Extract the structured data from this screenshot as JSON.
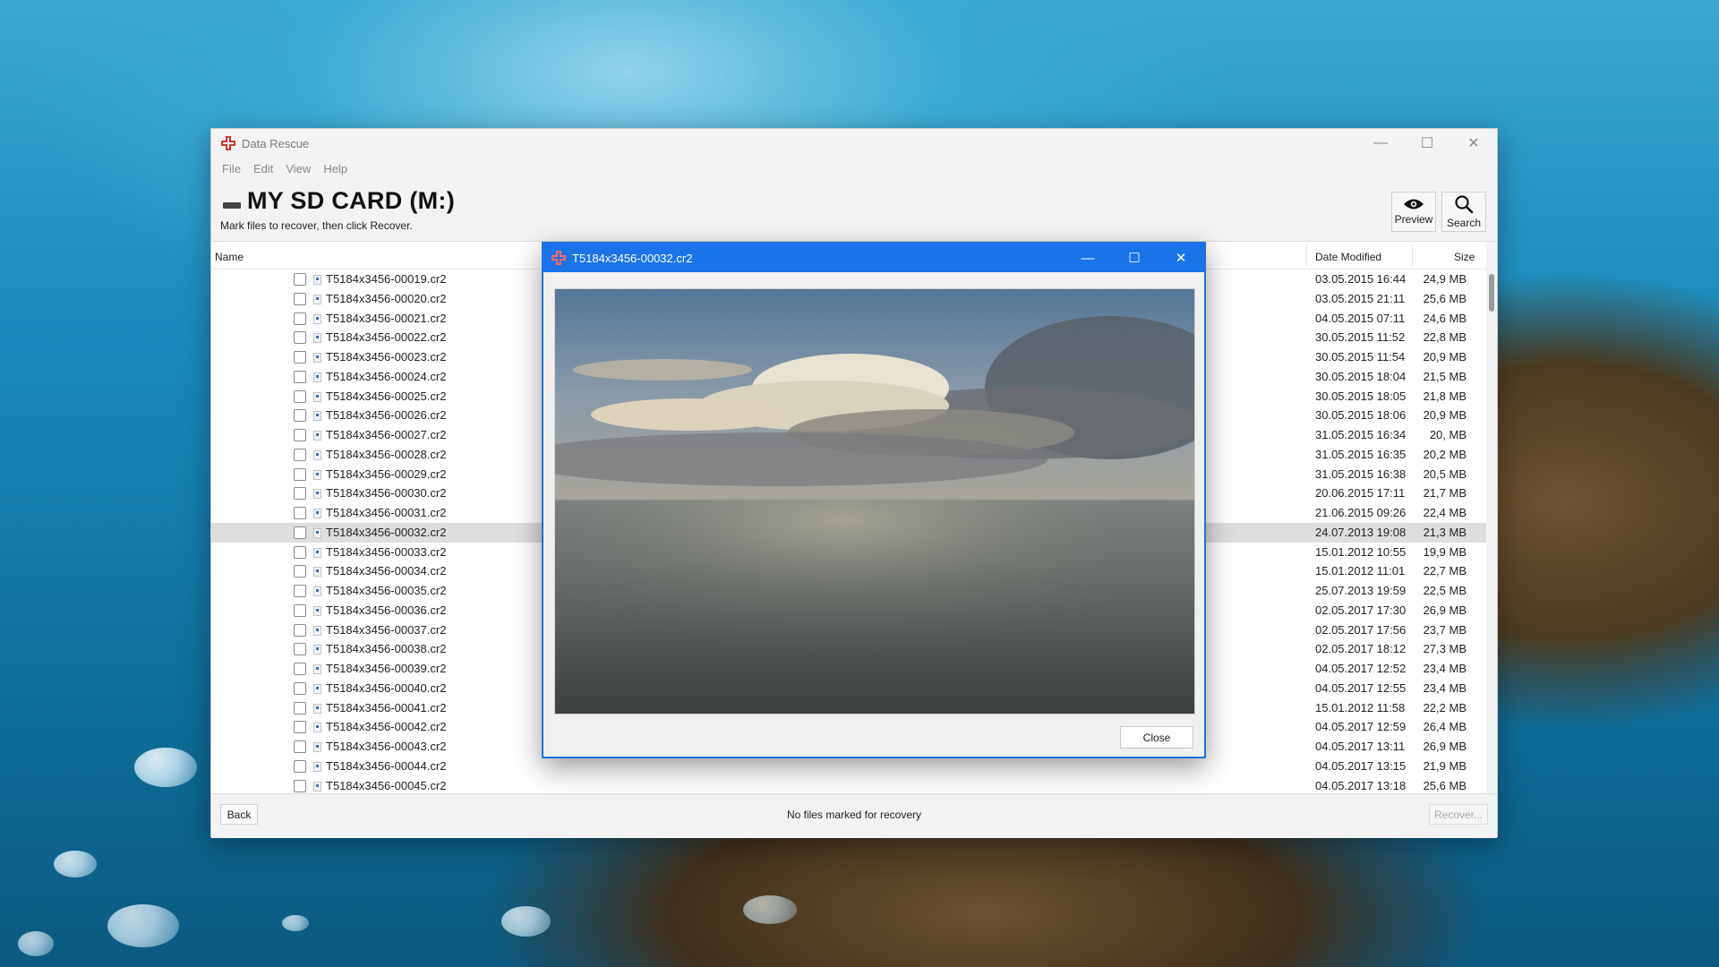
{
  "window": {
    "title": "Data Rescue",
    "controls": {
      "minimize": "—",
      "maximize": "☐",
      "close": "✕"
    }
  },
  "menu": [
    "File",
    "Edit",
    "View",
    "Help"
  ],
  "header": {
    "drive_title": "MY SD CARD (M:)",
    "subtitle": "Mark files to recover, then click Recover."
  },
  "toolbar": {
    "preview_label": "Preview",
    "search_label": "Search"
  },
  "columns": {
    "name": "Name",
    "date": "Date Modified",
    "size": "Size"
  },
  "files": [
    {
      "name": "T5184x3456-00019.cr2",
      "date": "03.05.2015 16:44",
      "size": "24,9 MB"
    },
    {
      "name": "T5184x3456-00020.cr2",
      "date": "03.05.2015 21:11",
      "size": "25,6 MB"
    },
    {
      "name": "T5184x3456-00021.cr2",
      "date": "04.05.2015 07:11",
      "size": "24,6 MB"
    },
    {
      "name": "T5184x3456-00022.cr2",
      "date": "30.05.2015 11:52",
      "size": "22,8 MB"
    },
    {
      "name": "T5184x3456-00023.cr2",
      "date": "30.05.2015 11:54",
      "size": "20,9 MB"
    },
    {
      "name": "T5184x3456-00024.cr2",
      "date": "30.05.2015 18:04",
      "size": "21,5 MB"
    },
    {
      "name": "T5184x3456-00025.cr2",
      "date": "30.05.2015 18:05",
      "size": "21,8 MB"
    },
    {
      "name": "T5184x3456-00026.cr2",
      "date": "30.05.2015 18:06",
      "size": "20,9 MB"
    },
    {
      "name": "T5184x3456-00027.cr2",
      "date": "31.05.2015 16:34",
      "size": "20, MB"
    },
    {
      "name": "T5184x3456-00028.cr2",
      "date": "31.05.2015 16:35",
      "size": "20,2 MB"
    },
    {
      "name": "T5184x3456-00029.cr2",
      "date": "31.05.2015 16:38",
      "size": "20,5 MB"
    },
    {
      "name": "T5184x3456-00030.cr2",
      "date": "20.06.2015 17:11",
      "size": "21,7 MB"
    },
    {
      "name": "T5184x3456-00031.cr2",
      "date": "21.06.2015 09:26",
      "size": "22,4 MB"
    },
    {
      "name": "T5184x3456-00032.cr2",
      "date": "24.07.2013 19:08",
      "size": "21,3 MB",
      "selected": true
    },
    {
      "name": "T5184x3456-00033.cr2",
      "date": "15.01.2012 10:55",
      "size": "19,9 MB"
    },
    {
      "name": "T5184x3456-00034.cr2",
      "date": "15.01.2012 11:01",
      "size": "22,7 MB"
    },
    {
      "name": "T5184x3456-00035.cr2",
      "date": "25.07.2013 19:59",
      "size": "22,5 MB"
    },
    {
      "name": "T5184x3456-00036.cr2",
      "date": "02.05.2017 17:30",
      "size": "26,9 MB"
    },
    {
      "name": "T5184x3456-00037.cr2",
      "date": "02.05.2017 17:56",
      "size": "23,7 MB"
    },
    {
      "name": "T5184x3456-00038.cr2",
      "date": "02.05.2017 18:12",
      "size": "27,3 MB"
    },
    {
      "name": "T5184x3456-00039.cr2",
      "date": "04.05.2017 12:52",
      "size": "23,4 MB"
    },
    {
      "name": "T5184x3456-00040.cr2",
      "date": "04.05.2017 12:55",
      "size": "23,4 MB"
    },
    {
      "name": "T5184x3456-00041.cr2",
      "date": "15.01.2012 11:58",
      "size": "22,2 MB"
    },
    {
      "name": "T5184x3456-00042.cr2",
      "date": "04.05.2017 12:59",
      "size": "26,4 MB"
    },
    {
      "name": "T5184x3456-00043.cr2",
      "date": "04.05.2017 13:11",
      "size": "26,9 MB"
    },
    {
      "name": "T5184x3456-00044.cr2",
      "date": "04.05.2017 13:15",
      "size": "21,9 MB"
    },
    {
      "name": "T5184x3456-00045.cr2",
      "date": "04.05.2017 13:18",
      "size": "25,6 MB"
    }
  ],
  "footer": {
    "back_label": "Back",
    "status": "No files marked for recovery",
    "recover_label": "Recover..."
  },
  "preview_dialog": {
    "title": "T5184x3456-00032.cr2",
    "close_label": "Close",
    "controls": {
      "minimize": "—",
      "maximize": "☐",
      "close": "✕"
    }
  },
  "colors": {
    "accent": "#1a73e8",
    "selected_row": "#dedede",
    "logo": "#d9342b"
  }
}
